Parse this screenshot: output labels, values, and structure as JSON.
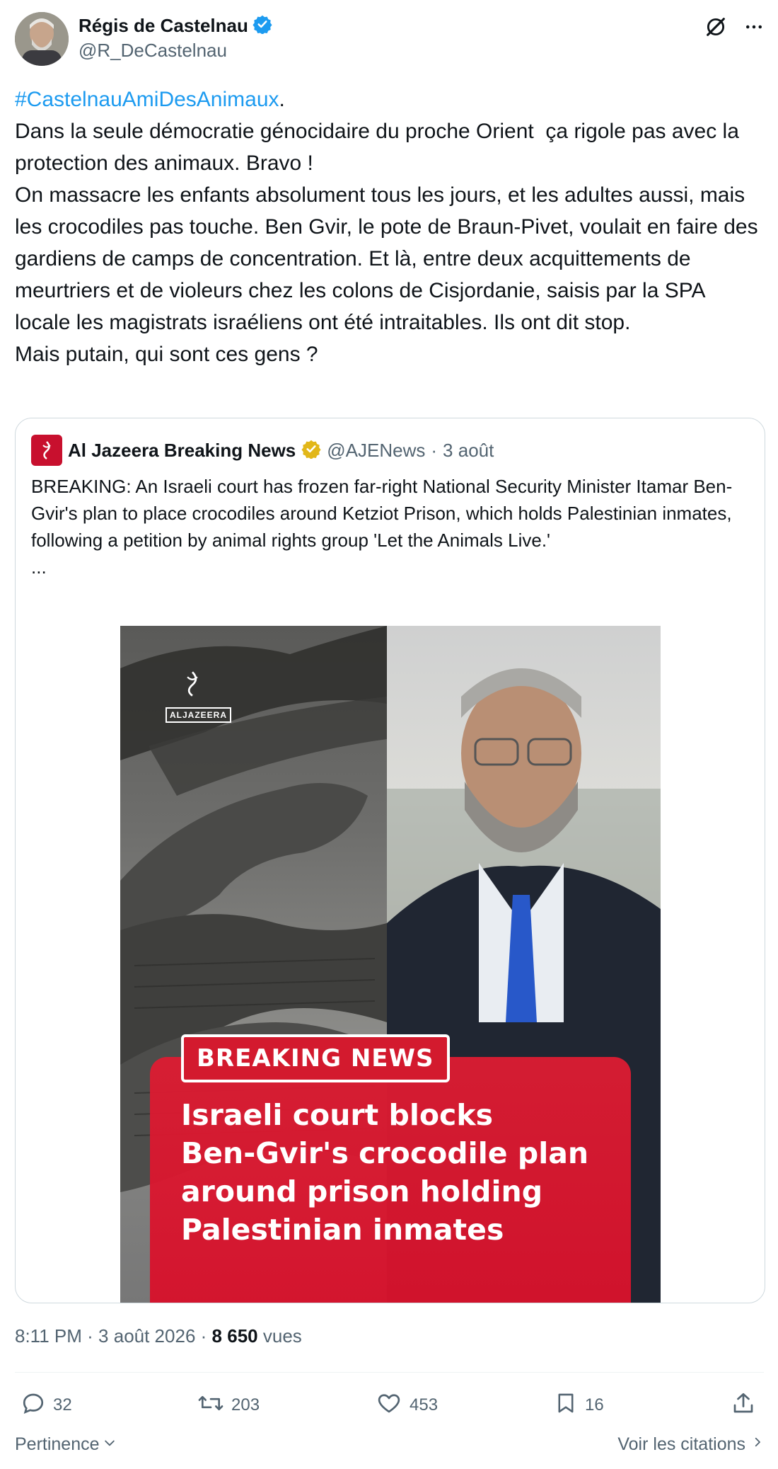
{
  "author": {
    "display_name": "Régis de Castelnau",
    "handle": "@R_DeCastelnau",
    "verified": true
  },
  "tweet": {
    "hashtag": "#CastelnauAmiDesAnimaux",
    "after_hashtag": ".",
    "body": "Dans la seule démocratie génocidaire du proche Orient  ça rigole pas avec la protection des animaux. Bravo !\nOn massacre les enfants absolument tous les jours, et les adultes aussi, mais les crocodiles pas touche. Ben Gvir, le pote de Braun-Pivet, voulait en faire des gardiens de camps de concentration. Et là, entre deux acquittements de meurtriers et de violeurs chez les colons de Cisjordanie, saisis par la SPA locale les magistrats israéliens ont été intraitables. Ils ont dit stop.\nMais putain, qui sont ces gens ?"
  },
  "quote": {
    "display_name": "Al Jazeera Breaking News",
    "handle": "@AJENews",
    "separator": "·",
    "date": "3 août",
    "text": "BREAKING: An Israeli court has frozen far-right National Security Minister Itamar Ben-Gvir's plan to place crocodiles around Ketziot Prison, which holds Palestinian inmates, following a petition by animal rights group 'Let the Animals Live.'\n...",
    "image": {
      "watermark": "ALJAZEERA",
      "badge": "BREAKING NEWS",
      "headline": "Israeli court blocks\nBen-Gvir's crocodile plan\naround prison holding\nPalestinian inmates"
    }
  },
  "meta": {
    "time": "8:11 PM",
    "sep1": "·",
    "date": "3 août 2026",
    "sep2": "·",
    "views_count": "8 650",
    "views_label": "vues"
  },
  "actions": {
    "replies": "32",
    "reposts": "203",
    "likes": "453",
    "bookmarks": "16"
  },
  "footer": {
    "sort_label": "Pertinence",
    "quotes_link": "Voir les citations"
  },
  "colors": {
    "accent": "#1d9bf0",
    "secondary_text": "#536471",
    "breaking_red": "#d31a2e",
    "gold_badge": "#e2b719"
  }
}
